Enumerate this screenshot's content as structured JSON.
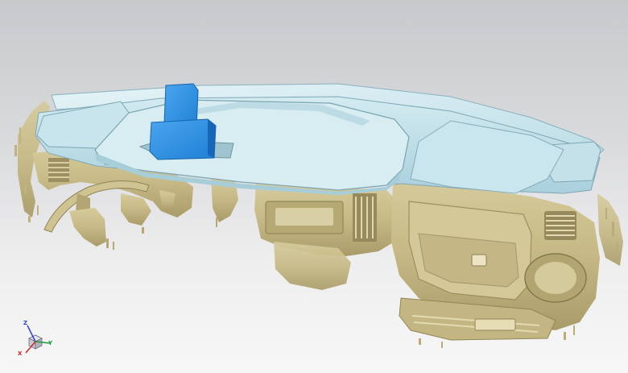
{
  "viewport": {
    "background_top": "#c7c9cc",
    "background_bottom": "#f7f7f7"
  },
  "model": {
    "scan_color": "#c9bc8a",
    "scan_shadow": "#8f8458",
    "cad_color": "#b9dbe5",
    "cad_edge": "#6f9aa8",
    "fixture_color": "#2e8fe0"
  },
  "triad": {
    "icon": "coordinate-triad-icon",
    "z_label": "Z",
    "y_label": "Y",
    "x_label": "X",
    "z_color": "#2b3fd0",
    "y_color": "#1e9a3a",
    "x_color": "#d02424"
  }
}
